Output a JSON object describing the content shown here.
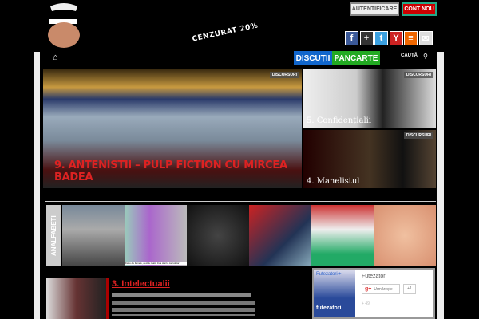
{
  "header": {
    "slogan": "CENZURAT 20%",
    "login": "AUTENTIFICARE",
    "register": "CONT NOU",
    "social": [
      {
        "icon": "facebook-icon",
        "glyph": "f",
        "color": "#3b5998"
      },
      {
        "icon": "google-plus-icon",
        "glyph": "+",
        "color": "#333"
      },
      {
        "icon": "twitter-icon",
        "glyph": "t",
        "color": "#3aa0e0"
      },
      {
        "icon": "youtube-icon",
        "glyph": "Y",
        "color": "#c22"
      },
      {
        "icon": "rss-icon",
        "glyph": "≡",
        "color": "#e60"
      },
      {
        "icon": "email-icon",
        "glyph": "✉",
        "color": "#ddd"
      }
    ]
  },
  "nav": {
    "tabs": [
      {
        "label": "DISCUȚII",
        "color": "#1166cc"
      },
      {
        "label": "PANCARTE",
        "color": "#22aa22"
      }
    ],
    "search": "CAUTĂ"
  },
  "featured": {
    "title": "9. ANTENISTII – PULP FICTION CU MIRCEA BADEA",
    "badge": "DISCURSURI"
  },
  "side": [
    {
      "title": "5. Confidențialii",
      "badge": "DISCURSURI"
    },
    {
      "title": "4. Manelistul",
      "badge": "DISCURSURI"
    }
  ],
  "strip": {
    "label": "ANALFABETI",
    "caption": "Bravo de femeie, deci tu toată ziua stai la calculator"
  },
  "article": {
    "title": "3. Intelectualii"
  },
  "widget": {
    "name": "Futezatori",
    "follow": "Urmărește",
    "plus": "+1",
    "count": "+ 49",
    "logo": "Futezatorii+",
    "logo2": "futezatorii"
  }
}
